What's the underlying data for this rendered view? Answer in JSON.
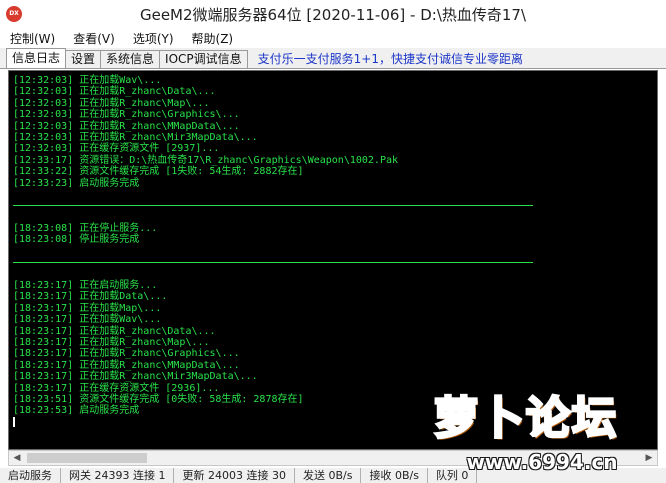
{
  "window": {
    "title": "GeeM2微端服务器64位 [2020-11-06] - D:\\热血传奇17\\",
    "icon": "app-icon"
  },
  "menu": [
    {
      "label": "控制(W)"
    },
    {
      "label": "查看(V)"
    },
    {
      "label": "选项(Y)"
    },
    {
      "label": "帮助(Z)"
    }
  ],
  "tabs": [
    {
      "label": "信息日志",
      "active": true
    },
    {
      "label": "设置"
    },
    {
      "label": "系统信息"
    },
    {
      "label": "IOCP调试信息"
    }
  ],
  "ad_text": "支付乐一支付服务1+1，快捷支付诚信专业零距离",
  "log": [
    {
      "text": "[12:32:03] 正在加载Wav\\..."
    },
    {
      "text": "[12:32:03] 正在加载R_zhanc\\Data\\..."
    },
    {
      "text": "[12:32:03] 正在加载R_zhanc\\Map\\..."
    },
    {
      "text": "[12:32:03] 正在加载R_zhanc\\Graphics\\..."
    },
    {
      "text": "[12:32:03] 正在加载R_zhanc\\MMapData\\..."
    },
    {
      "text": "[12:32:03] 正在加载R_zhanc\\Mir3MapData\\..."
    },
    {
      "text": "[12:32:03] 正在缓存资源文件 [2937]..."
    },
    {
      "text": "[12:33:17] 资源错误：D:\\热血传奇17\\R_zhanc\\Graphics\\Weapon\\1002.Pak"
    },
    {
      "text": "[12:33:22] 资源文件缓存完成 [1失败: 54生成: 2882存在]"
    },
    {
      "text": "[12:33:23] 启动服务完成"
    },
    {
      "text": ""
    },
    {
      "text": "",
      "sep": true
    },
    {
      "text": ""
    },
    {
      "text": "[18:23:08] 正在停止服务..."
    },
    {
      "text": "[18:23:08] 停止服务完成"
    },
    {
      "text": ""
    },
    {
      "text": "",
      "sep": true
    },
    {
      "text": ""
    },
    {
      "text": "[18:23:17] 正在启动服务..."
    },
    {
      "text": "[18:23:17] 正在加载Data\\..."
    },
    {
      "text": "[18:23:17] 正在加载Map\\..."
    },
    {
      "text": "[18:23:17] 正在加载Wav\\..."
    },
    {
      "text": "[18:23:17] 正在加载R_zhanc\\Data\\..."
    },
    {
      "text": "[18:23:17] 正在加载R_zhanc\\Map\\..."
    },
    {
      "text": "[18:23:17] 正在加载R_zhanc\\Graphics\\..."
    },
    {
      "text": "[18:23:17] 正在加载R_zhanc\\MMapData\\..."
    },
    {
      "text": "[18:23:17] 正在加载R_zhanc\\Mir3MapData\\..."
    },
    {
      "text": "[18:23:17] 正在缓存资源文件 [2936]..."
    },
    {
      "text": "[18:23:51] 资源文件缓存完成 [0失败: 58生成: 2878存在]"
    },
    {
      "text": "[18:23:53] 启动服务完成"
    }
  ],
  "status": [
    {
      "text": "启动服务"
    },
    {
      "text": "网关 24393 连接 1"
    },
    {
      "text": "更新 24003 连接 30"
    },
    {
      "text": "发送 0B/s"
    },
    {
      "text": "接收 0B/s"
    },
    {
      "text": "队列 0"
    }
  ],
  "watermark": {
    "logo_text": "萝卜论坛",
    "url": "www.6994.cn"
  },
  "colors": {
    "log_green": "#29e24a",
    "console_bg": "#000000",
    "ad_blue": "#1c36c8"
  }
}
